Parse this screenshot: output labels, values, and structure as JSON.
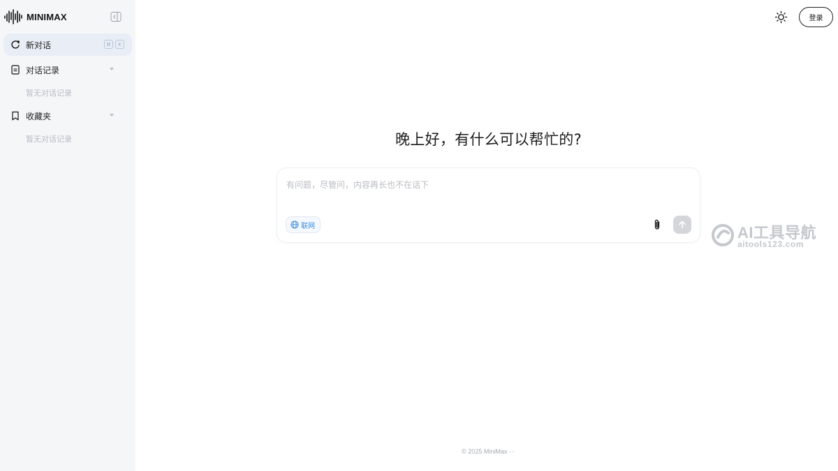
{
  "brand": {
    "name": "MINIMAX"
  },
  "sidebar": {
    "new_chat": {
      "label": "新对话",
      "shortcut": [
        "⌘",
        "K"
      ]
    },
    "history": {
      "label": "对话记录",
      "empty": "暂无对话记录"
    },
    "favorites": {
      "label": "收藏夹",
      "empty": "暂无对话记录"
    }
  },
  "header": {
    "login_label": "登录"
  },
  "main": {
    "greeting": "晚上好，有什么可以帮忙的?",
    "composer": {
      "placeholder": "有问题，尽管问，内容再长也不在话下",
      "web_search_label": "联网"
    }
  },
  "watermark": {
    "title": "AI工具导航",
    "url": "aitools123.com"
  },
  "footer": {
    "text": "© 2025 MiniMax ···"
  },
  "colors": {
    "accent": "#3a8de0",
    "sidebar_bg": "#f5f6f8",
    "active_item_bg": "#e9eef6"
  }
}
